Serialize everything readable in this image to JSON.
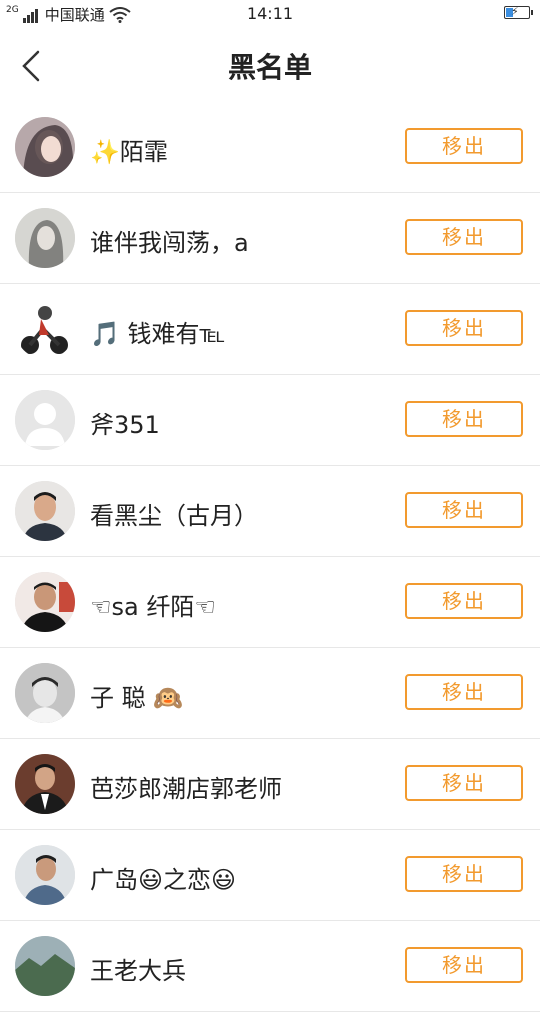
{
  "status_bar": {
    "network_type": "2G",
    "carrier": "中国联通",
    "time": "14:11"
  },
  "header": {
    "title": "黑名单"
  },
  "blacklist": [
    {
      "name": "✨陌霏",
      "action": "移出"
    },
    {
      "name": "谁伴我闯荡，a",
      "action": "移出"
    },
    {
      "name": "🎵 钱难有℡",
      "action": "移出"
    },
    {
      "name": "斧351",
      "action": "移出"
    },
    {
      "name": "看黑尘（古月）",
      "action": "移出"
    },
    {
      "name": "☜sa 纤陌☜",
      "action": "移出"
    },
    {
      "name": "子 聪 🙉",
      "action": "移出"
    },
    {
      "name": "芭莎郎潮店郭老师",
      "action": "移出"
    },
    {
      "name": "广岛😃之恋😃",
      "action": "移出"
    },
    {
      "name": "王老大兵",
      "action": "移出"
    }
  ],
  "colors": {
    "accent": "#f29a2e",
    "divider": "#e7e7e7",
    "text": "#222222"
  }
}
